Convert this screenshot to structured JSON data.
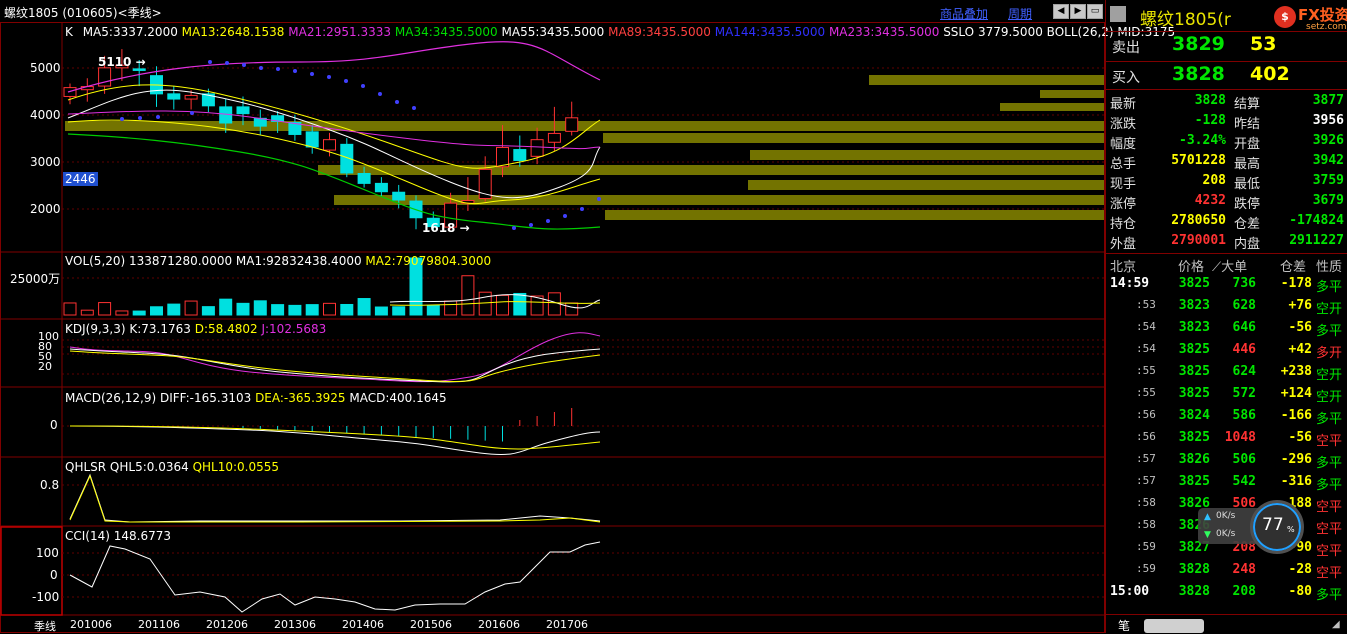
{
  "header": {
    "title": "螺纹1805 (010605)<季线>",
    "link_overlay": "商品叠加",
    "link_period": "周期"
  },
  "indicators": {
    "k": "K",
    "ma5": "MA5:3337.2000",
    "ma13": "MA13:2648.1538",
    "ma21": "MA21:2951.3333",
    "ma34": "MA34:3435.5000",
    "ma55": "MA55:3435.5000",
    "ma89": "MA89:3435.5000",
    "ma144": "MA144:3435.5000",
    "ma233": "MA233:3435.5000",
    "sslo": "SSLO 3779.5000",
    "boll": "BOLL(26,2) MID:3175",
    "vol": "VOL(5,20) 133871280.0000",
    "vol_ma1": "MA1:92832438.4000",
    "vol_ma2": "MA2:79079804.3000",
    "kdj": "KDJ(9,3,3) K:73.1763",
    "kdj_d": "D:58.4802",
    "kdj_j": "J:102.5683",
    "macd": "MACD(26,12,9) DIFF:-165.3103",
    "macd_dea": "DEA:-365.3925",
    "macd_val": "MACD:400.1645",
    "qhlsr": "QHLSR QHL5:0.0364",
    "qhl10": "QHL10:0.0555",
    "cci": "CCI(14) 148.6773"
  },
  "axes": {
    "price": [
      "5000",
      "4000",
      "3000",
      "2000"
    ],
    "vol": [
      "25000万"
    ],
    "kdj": [
      "100",
      "80",
      "50",
      "20"
    ],
    "macd": [
      "0"
    ],
    "qhlsr": [
      "0.8"
    ],
    "cci": [
      "100",
      "0",
      "-100"
    ],
    "dates": [
      "201006",
      "201106",
      "201206",
      "201306",
      "201406",
      "201506",
      "201606",
      "201706"
    ],
    "period_label": "季线",
    "cursor_price": "2446",
    "high_mark": "5110",
    "low_mark": "1618"
  },
  "chart_data": {
    "type": "candlestick",
    "x": [
      "2010Q3",
      "2010Q4",
      "2011Q1",
      "2011Q2",
      "2011Q3",
      "2011Q4",
      "2012Q1",
      "2012Q2",
      "2012Q3",
      "2012Q4",
      "2013Q1",
      "2013Q2",
      "2013Q3",
      "2013Q4",
      "2014Q1",
      "2014Q2",
      "2014Q3",
      "2014Q4",
      "2015Q1",
      "2015Q2",
      "2015Q3",
      "2015Q4",
      "2016Q1",
      "2016Q2",
      "2016Q3",
      "2016Q4",
      "2017Q1",
      "2017Q2",
      "2017Q3",
      "2017Q4"
    ],
    "open": [
      4200,
      4330,
      4400,
      4750,
      4730,
      4600,
      4250,
      4150,
      4250,
      4000,
      4000,
      3780,
      3830,
      3700,
      3520,
      3170,
      3280,
      2720,
      2530,
      2360,
      2190,
      1860,
      1690,
      2150,
      2240,
      2850,
      3180,
      3050,
      3320,
      3530
    ],
    "close": [
      4370,
      4390,
      4750,
      4800,
      4700,
      4250,
      4150,
      4220,
      4020,
      3690,
      3870,
      3630,
      3720,
      3470,
      3230,
      3370,
      2730,
      2530,
      2370,
      2210,
      1870,
      1700,
      2150,
      2200,
      2800,
      3220,
      2970,
      3370,
      3490,
      3790
    ],
    "high": [
      4450,
      4550,
      4980,
      5110,
      4900,
      4780,
      4400,
      4320,
      4350,
      4150,
      4200,
      3950,
      3920,
      3850,
      3650,
      3500,
      3400,
      2850,
      2650,
      2500,
      2300,
      1990,
      2350,
      2650,
      3050,
      3650,
      3450,
      3600,
      4000,
      4100
    ],
    "low": [
      4050,
      4100,
      4250,
      4500,
      4400,
      4000,
      3950,
      3950,
      3900,
      3500,
      3650,
      3450,
      3500,
      3350,
      3100,
      3050,
      2650,
      2450,
      2280,
      2050,
      1650,
      1618,
      1650,
      2000,
      2180,
      2650,
      2850,
      2900,
      3150,
      3450
    ],
    "volume_wan": [
      950,
      380,
      980,
      320,
      310,
      650,
      860,
      1100,
      660,
      1250,
      920,
      1120,
      820,
      760,
      820,
      920,
      830,
      1300,
      630,
      650,
      4500,
      750,
      1100,
      3100,
      1800,
      1550,
      1700,
      1500,
      1750,
      950
    ],
    "yrange": [
      1500,
      5400
    ]
  },
  "quote": {
    "name": "螺纹1805(r",
    "sell_label": "卖出",
    "sell_price": "3829",
    "sell_qty": "53",
    "buy_label": "买入",
    "buy_price": "3828",
    "buy_qty": "402",
    "rows": [
      {
        "l1": "最新",
        "v1": "3828",
        "c1": "dn",
        "l2": "结算",
        "v2": "3877",
        "c2": "dn"
      },
      {
        "l1": "涨跌",
        "v1": "-128",
        "c1": "dn",
        "l2": "昨结",
        "v2": "3956",
        "c2": "wh"
      },
      {
        "l1": "幅度",
        "v1": "-3.24%",
        "c1": "dn",
        "l2": "开盘",
        "v2": "3926",
        "c2": "dn"
      },
      {
        "l1": "总手",
        "v1": "5701228",
        "c1": "yl",
        "l2": "最高",
        "v2": "3942",
        "c2": "dn"
      },
      {
        "l1": "现手",
        "v1": "208",
        "c1": "yl",
        "l2": "最低",
        "v2": "3759",
        "c2": "dn"
      },
      {
        "l1": "涨停",
        "v1": "4232",
        "c1": "up",
        "l2": "跌停",
        "v2": "3679",
        "c2": "dn"
      },
      {
        "l1": "持仓",
        "v1": "2780650",
        "c1": "yl",
        "l2": "仓差",
        "v2": "-174824",
        "c2": "dn"
      },
      {
        "l1": "外盘",
        "v1": "2790001",
        "c1": "up",
        "l2": "内盘",
        "v2": "2911227",
        "c2": "dn"
      }
    ]
  },
  "trades": {
    "headers": [
      "北京",
      "价格",
      "⟋大单",
      "仓差",
      "性质"
    ],
    "rows": [
      {
        "t": "14:59",
        "p": "3825",
        "v": "736",
        "vc": "dn",
        "d": "-178",
        "dc": "yl",
        "n": "多平",
        "nc": "dn"
      },
      {
        "t": ":53",
        "p": "3823",
        "v": "628",
        "vc": "dn",
        "d": "+76",
        "dc": "yl",
        "n": "空开",
        "nc": "dn"
      },
      {
        "t": ":54",
        "p": "3823",
        "v": "646",
        "vc": "dn",
        "d": "-56",
        "dc": "yl",
        "n": "多平",
        "nc": "dn"
      },
      {
        "t": ":54",
        "p": "3825",
        "v": "446",
        "vc": "up",
        "d": "+42",
        "dc": "yl",
        "n": "多开",
        "nc": "up"
      },
      {
        "t": ":55",
        "p": "3825",
        "v": "624",
        "vc": "dn",
        "d": "+238",
        "dc": "yl",
        "n": "空开",
        "nc": "dn"
      },
      {
        "t": ":55",
        "p": "3825",
        "v": "572",
        "vc": "dn",
        "d": "+124",
        "dc": "yl",
        "n": "空开",
        "nc": "dn"
      },
      {
        "t": ":56",
        "p": "3824",
        "v": "586",
        "vc": "dn",
        "d": "-166",
        "dc": "yl",
        "n": "多平",
        "nc": "dn"
      },
      {
        "t": ":56",
        "p": "3825",
        "v": "1048",
        "vc": "up",
        "d": "-56",
        "dc": "yl",
        "n": "空平",
        "nc": "up"
      },
      {
        "t": ":57",
        "p": "3826",
        "v": "506",
        "vc": "dn",
        "d": "-296",
        "dc": "yl",
        "n": "多平",
        "nc": "dn"
      },
      {
        "t": ":57",
        "p": "3825",
        "v": "542",
        "vc": "dn",
        "d": "-316",
        "dc": "yl",
        "n": "多平",
        "nc": "dn"
      },
      {
        "t": ":58",
        "p": "3826",
        "v": "506",
        "vc": "up",
        "d": "-188",
        "dc": "yl",
        "n": "空平",
        "nc": "up"
      },
      {
        "t": ":58",
        "p": "3826",
        "v": "",
        "vc": "up",
        "d": "",
        "dc": "yl",
        "n": "空平",
        "nc": "up"
      },
      {
        "t": ":59",
        "p": "3827",
        "v": "208",
        "vc": "up",
        "d": "-90",
        "dc": "yl",
        "n": "空平",
        "nc": "up"
      },
      {
        "t": ":59",
        "p": "3828",
        "v": "248",
        "vc": "up",
        "d": "-28",
        "dc": "yl",
        "n": "空平",
        "nc": "up"
      },
      {
        "t": "15:00",
        "p": "3828",
        "v": "208",
        "vc": "dn",
        "d": "-80",
        "dc": "yl",
        "n": "多平",
        "nc": "dn"
      }
    ],
    "footer_tab": "笔"
  },
  "netmon": {
    "up": "0K/s",
    "down": "0K/s",
    "pct": "77"
  },
  "logo": {
    "text": "FX投资",
    "sub": "setz.com"
  }
}
